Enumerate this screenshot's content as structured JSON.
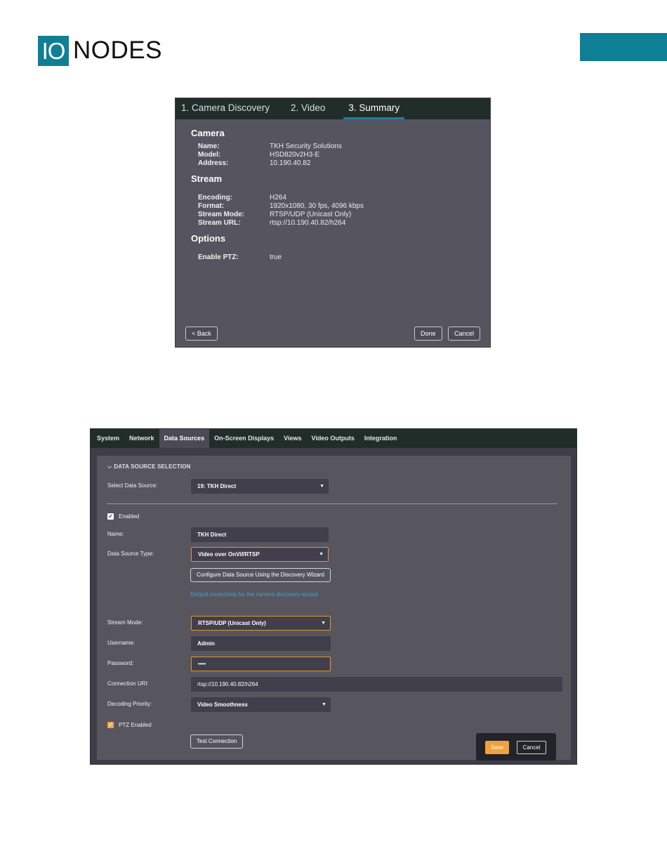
{
  "logo": {
    "mark": "IO",
    "word": "NODES"
  },
  "wizard": {
    "tabs": [
      "1. Camera Discovery",
      "2. Video",
      "3. Summary"
    ],
    "active_tab": 2,
    "sections": {
      "camera": {
        "title": "Camera",
        "rows": [
          {
            "key": "Name:",
            "value": "TKH Security Solutions"
          },
          {
            "key": "Model:",
            "value": "HSD820v2H3-E"
          },
          {
            "key": "Address:",
            "value": "10.190.40.82"
          }
        ]
      },
      "stream": {
        "title": "Stream",
        "rows": [
          {
            "key": "Encoding:",
            "value": "H264"
          },
          {
            "key": "Format:",
            "value": "1920x1080, 30 fps, 4096 kbps"
          },
          {
            "key": "Stream Mode:",
            "value": "RTSP/UDP (Unicast Only)"
          },
          {
            "key": "Stream URL:",
            "value": "rtsp://10.190.40.82/h264"
          }
        ]
      },
      "options": {
        "title": "Options",
        "rows": [
          {
            "key": "Enable PTZ:",
            "value": "true"
          }
        ]
      }
    },
    "buttons": {
      "back": "< Back",
      "done": "Done",
      "cancel": "Cancel"
    }
  },
  "settings": {
    "nav": [
      "System",
      "Network",
      "Data Sources",
      "On-Screen Displays",
      "Views",
      "Video Outputs",
      "Integration"
    ],
    "active_nav": 2,
    "section_title": "DATA SOURCE SELECTION",
    "select_data_source": {
      "label": "Select Data Source:",
      "value": "19: TKH Direct"
    },
    "enabled": {
      "label": "Enabled",
      "checked": true
    },
    "name": {
      "label": "Name:",
      "value": "TKH Direct"
    },
    "data_source_type": {
      "label": "Data Source Type:",
      "value": "Video over OnVif/RTSP"
    },
    "wizard_button": "Configure Data Source Using the Discovery Wizard",
    "default_credentials_link": "Default credentials for the camera discovery wizard",
    "stream_mode": {
      "label": "Stream Mode:",
      "value": "RTSP/UDP (Unicast Only)"
    },
    "username": {
      "label": "Username:",
      "value": "Admin"
    },
    "password": {
      "label": "Password:",
      "value": "••••"
    },
    "connection_uri": {
      "label": "Connection URI:",
      "value": "rtsp://10.190.40.82/h264"
    },
    "decoding_priority": {
      "label": "Decoding Priority:",
      "value": "Video Smoothness"
    },
    "ptz_enabled": {
      "label": "PTZ Enabled",
      "checked": true
    },
    "test_connection": "Test Connection",
    "save": "Save",
    "cancel": "Cancel"
  },
  "colors": {
    "brand": "#0f7f95",
    "accent_orange": "#f0a23e",
    "link_blue": "#3aa3d6"
  }
}
